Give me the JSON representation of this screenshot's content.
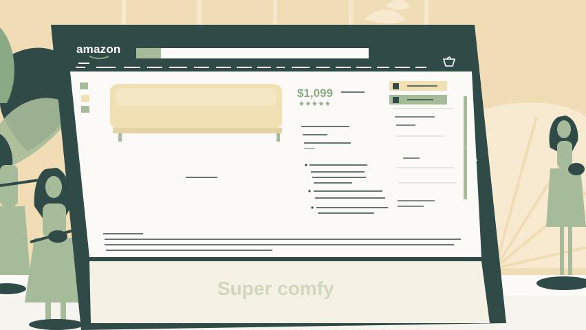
{
  "header": {
    "brand": "amazon",
    "search_placeholder": ""
  },
  "product": {
    "price": "$1,099",
    "rating_stars": "★★★★★"
  },
  "banner": {
    "text": "Super comfy"
  },
  "icons": {
    "cart": "cart-icon",
    "menu": "hamburger-icon"
  },
  "colors": {
    "background": "#f1ddb5",
    "screen_bezel": "#2f4a47",
    "accent_green": "#8aaa86",
    "sofa": "#f0e0b4",
    "page": "#fbfaf6"
  }
}
